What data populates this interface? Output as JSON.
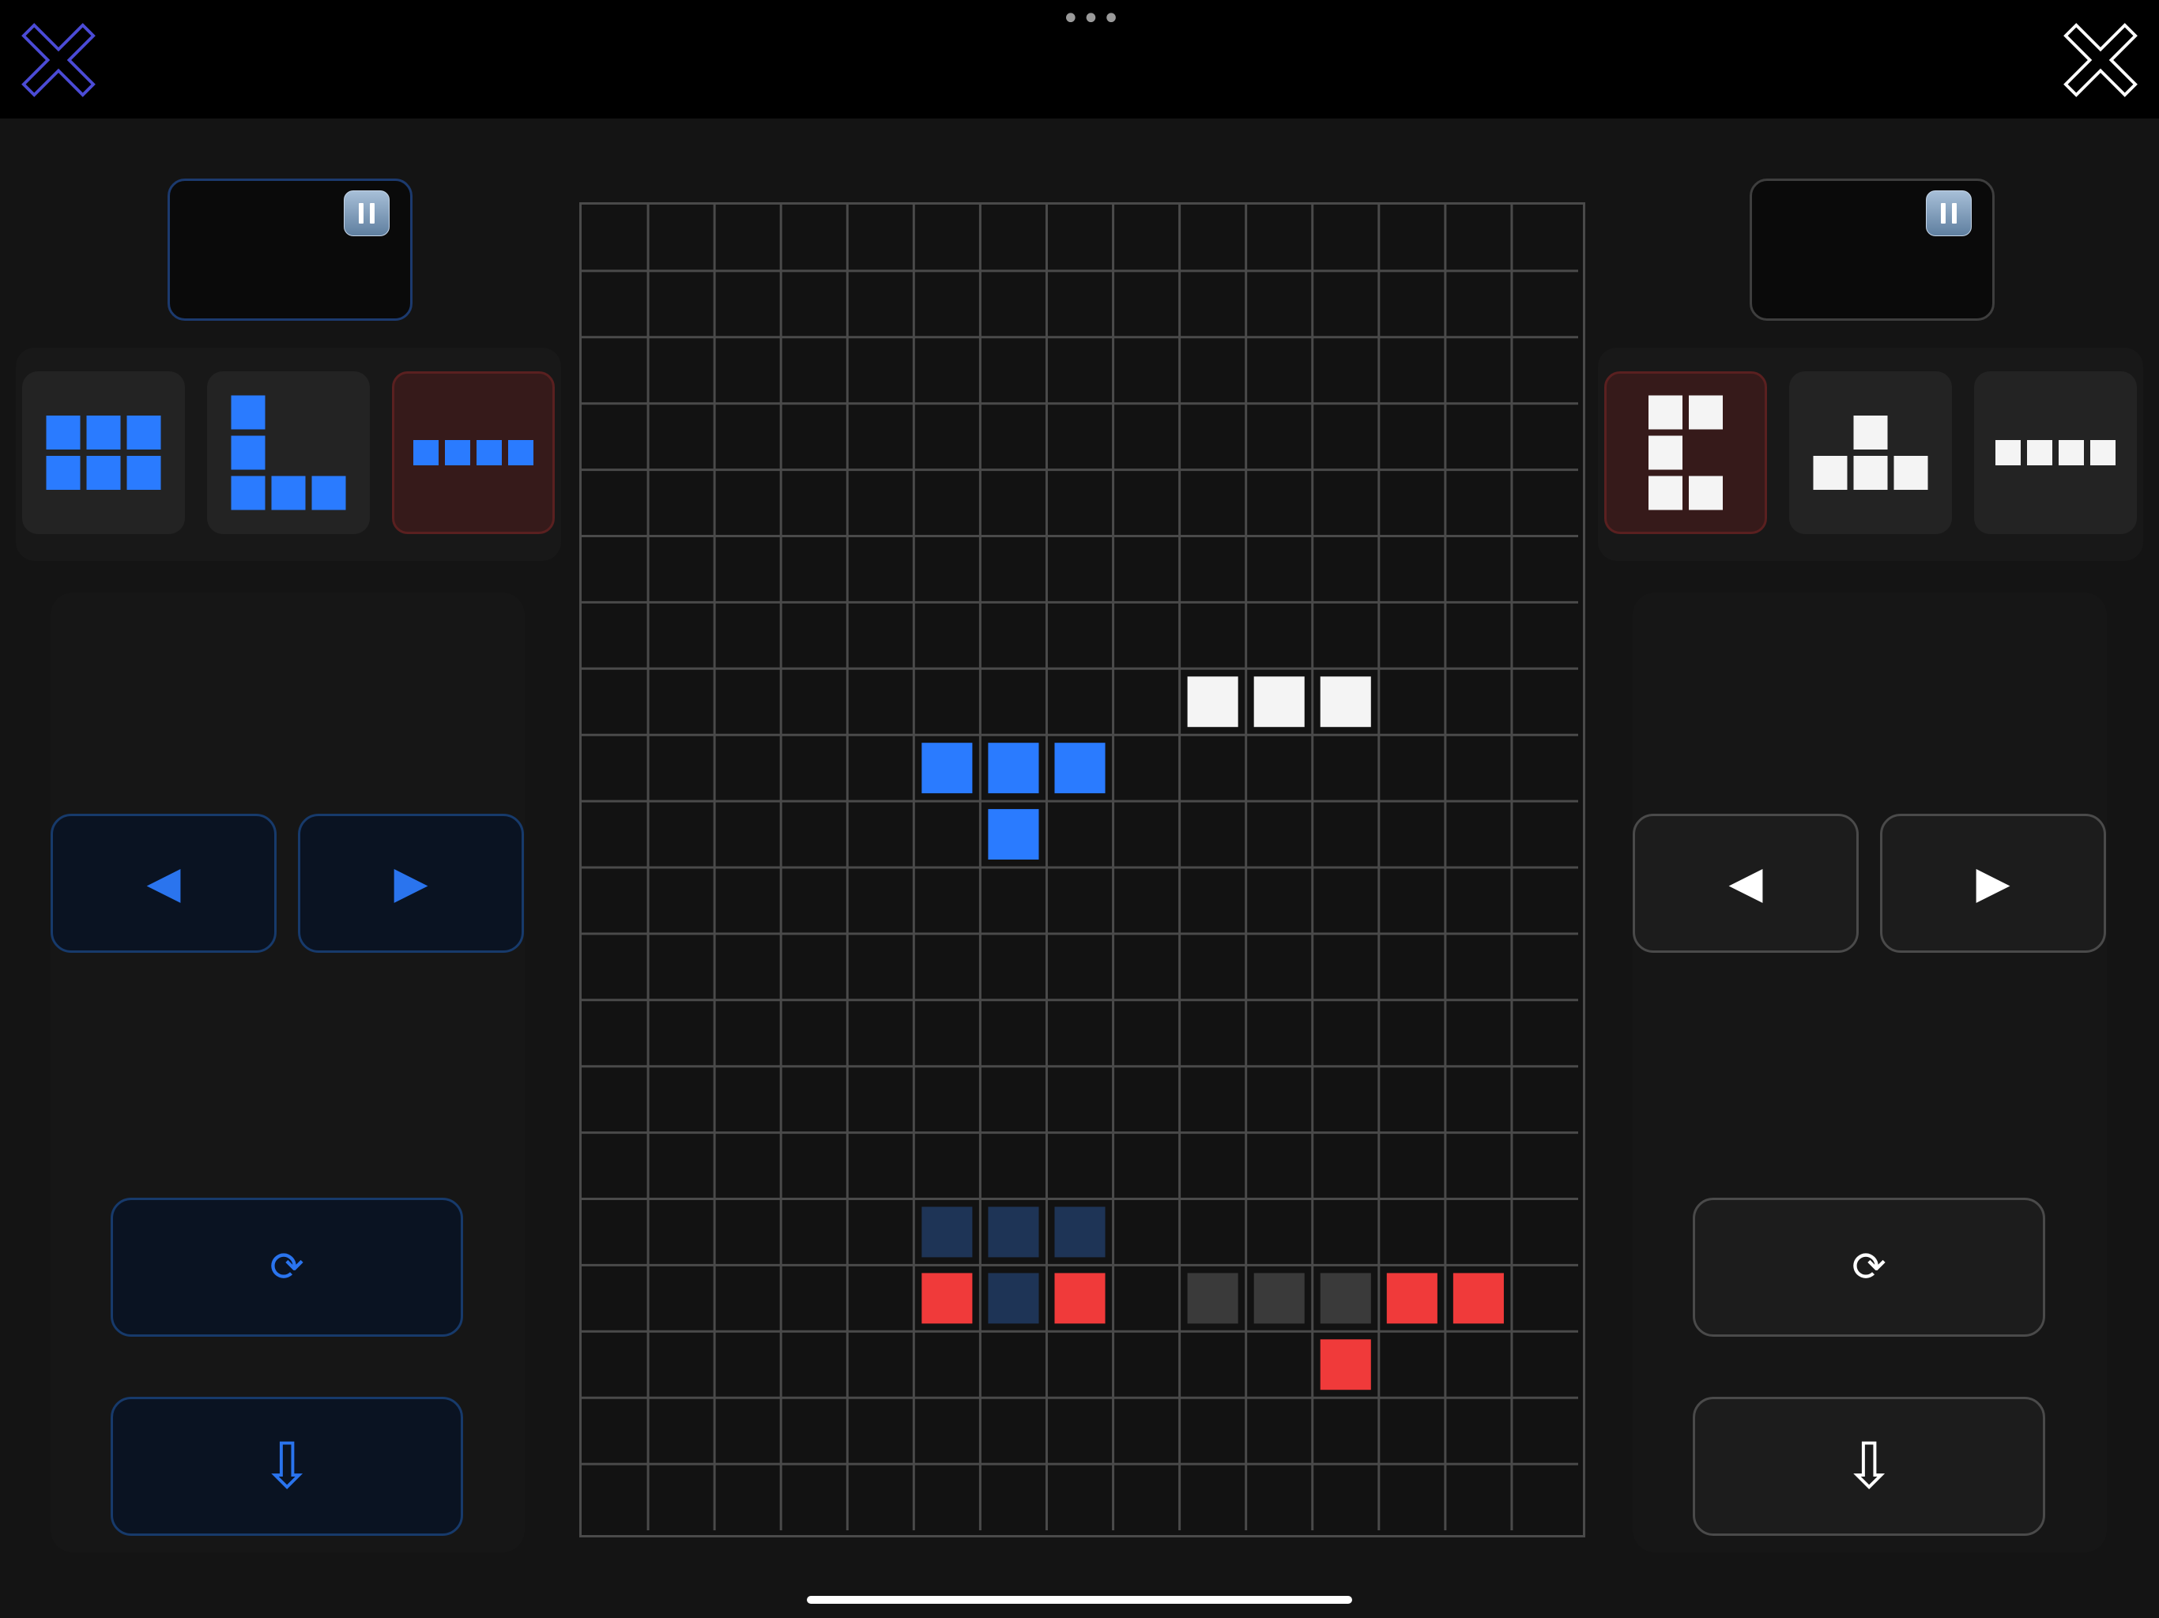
{
  "colors": {
    "player1": "#2a7bff",
    "player2": "#f4f4f4",
    "locked_red": "#f03a3a",
    "locked_gray": "#3a3a3a",
    "locked_navy": "#1e3456",
    "grid_line": "#4a4a4a",
    "board_bg": "#121212"
  },
  "topbar": {
    "left_close_icon": "close-icon",
    "right_close_icon": "close-icon",
    "menu_icon": "more-dots-icon"
  },
  "players": [
    {
      "id": "p1",
      "color": "#2a7bff",
      "pause_icon": "pause-icon",
      "pieces": [
        {
          "shape": "grid-3x2",
          "cells": [
            [
              0,
              0
            ],
            [
              1,
              0
            ],
            [
              2,
              0
            ],
            [
              0,
              1
            ],
            [
              1,
              1
            ],
            [
              2,
              1
            ]
          ],
          "selected": false
        },
        {
          "shape": "L",
          "cells": [
            [
              0,
              0
            ],
            [
              0,
              1
            ],
            [
              0,
              2
            ],
            [
              1,
              2
            ],
            [
              2,
              2
            ]
          ],
          "selected": false
        },
        {
          "shape": "I4",
          "cells": [
            [
              0,
              0
            ],
            [
              1,
              0
            ],
            [
              2,
              0
            ],
            [
              3,
              0
            ]
          ],
          "selected": true
        }
      ],
      "controls": {
        "left": "◀",
        "right": "▶",
        "rotate": "⟳",
        "drop": "⇩"
      }
    },
    {
      "id": "p2",
      "color": "#f4f4f4",
      "pause_icon": "pause-icon",
      "pieces": [
        {
          "shape": "C",
          "cells": [
            [
              0,
              0
            ],
            [
              1,
              0
            ],
            [
              0,
              1
            ],
            [
              0,
              2
            ],
            [
              1,
              2
            ]
          ],
          "selected": true
        },
        {
          "shape": "T",
          "cells": [
            [
              1,
              0
            ],
            [
              0,
              1
            ],
            [
              1,
              1
            ],
            [
              2,
              1
            ]
          ],
          "selected": false
        },
        {
          "shape": "I4",
          "cells": [
            [
              0,
              0
            ],
            [
              1,
              0
            ],
            [
              2,
              0
            ],
            [
              3,
              0
            ]
          ],
          "selected": false
        }
      ],
      "controls": {
        "left": "◀",
        "right": "▶",
        "rotate": "⟳",
        "drop": "⇩"
      }
    }
  ],
  "board": {
    "cols": 15,
    "rows": 20,
    "cells": [
      {
        "col": 9,
        "row": 7,
        "type": "player2"
      },
      {
        "col": 10,
        "row": 7,
        "type": "player2"
      },
      {
        "col": 11,
        "row": 7,
        "type": "player2"
      },
      {
        "col": 5,
        "row": 8,
        "type": "player1"
      },
      {
        "col": 6,
        "row": 8,
        "type": "player1"
      },
      {
        "col": 7,
        "row": 8,
        "type": "player1"
      },
      {
        "col": 6,
        "row": 9,
        "type": "player1"
      },
      {
        "col": 5,
        "row": 15,
        "type": "locked_navy"
      },
      {
        "col": 6,
        "row": 15,
        "type": "locked_navy"
      },
      {
        "col": 7,
        "row": 15,
        "type": "locked_navy"
      },
      {
        "col": 5,
        "row": 16,
        "type": "locked_red"
      },
      {
        "col": 6,
        "row": 16,
        "type": "locked_navy"
      },
      {
        "col": 7,
        "row": 16,
        "type": "locked_red"
      },
      {
        "col": 9,
        "row": 16,
        "type": "locked_gray"
      },
      {
        "col": 10,
        "row": 16,
        "type": "locked_gray"
      },
      {
        "col": 11,
        "row": 16,
        "type": "locked_gray"
      },
      {
        "col": 12,
        "row": 16,
        "type": "locked_red"
      },
      {
        "col": 13,
        "row": 16,
        "type": "locked_red"
      },
      {
        "col": 11,
        "row": 17,
        "type": "locked_red"
      }
    ]
  }
}
